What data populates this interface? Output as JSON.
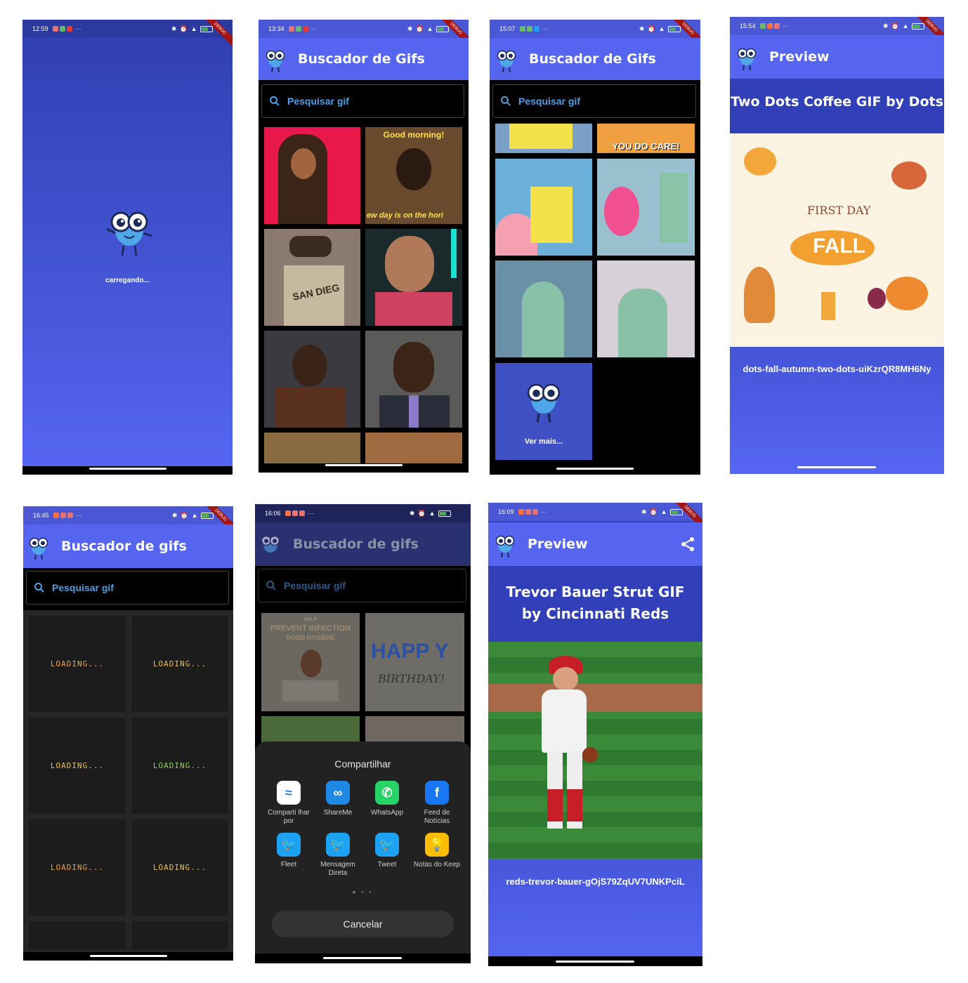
{
  "status": {
    "time_1": "12:59",
    "time_2": "13:34",
    "time_3": "15:07",
    "time_4": "15:54",
    "time_5": "16:45",
    "time_6": "16:06",
    "time_7": "16:09",
    "more": "···",
    "debug": "DEBUG"
  },
  "splash": {
    "loading_text": "carregando..."
  },
  "home": {
    "title": "Buscador de Gifs",
    "title_lower": "Buscador de gifs",
    "search_placeholder": "Pesquisar gif"
  },
  "gifs": {
    "good_morning": "Good morning!",
    "new_day": "ew day is on the hori",
    "san_diego": "SAN DIEG",
    "you_do_care": "YOU DO CARE!",
    "prevent": "PREVENT INFECTION",
    "help": "HELP",
    "good_hygiene": "GOOD HYGIENE",
    "happy": "HAPP Y",
    "birthday": "BIRTHDAY!",
    "first_day": "FIRST DAY",
    "fall": "FALL"
  },
  "more_tile": {
    "label": "Ver mais..."
  },
  "loading_tile": {
    "label": "LOADING..."
  },
  "preview": {
    "title": "Preview",
    "preview1_name": "Two Dots Coffee GIF by Dots",
    "preview1_slug": "dots-fall-autumn-two-dots-uiKzrQR8MH6Ny",
    "preview2_name": "Trevor Bauer Strut GIF by Cincinnati Reds",
    "preview2_slug": "reds-trevor-bauer-gOjS79ZqUV7UNKPciL"
  },
  "share": {
    "title": "Compartilhar",
    "cancel": "Cancelar",
    "apps": [
      {
        "label": "Comparti lhar por",
        "icon": "share-via-icon",
        "color": "#ffffff"
      },
      {
        "label": "ShareMe",
        "icon": "shareme-icon",
        "color": "#1e88e5"
      },
      {
        "label": "WhatsApp",
        "icon": "whatsapp-icon",
        "color": "#25d366"
      },
      {
        "label": "Feed de Notícias",
        "icon": "facebook-icon",
        "color": "#1877f2"
      },
      {
        "label": "Fleet",
        "icon": "twitter-icon",
        "color": "#1da1f2"
      },
      {
        "label": "Mensagem Direta",
        "icon": "twitter-icon",
        "color": "#1da1f2"
      },
      {
        "label": "Tweet",
        "icon": "twitter-icon",
        "color": "#1da1f2"
      },
      {
        "label": "Notas do Keep",
        "icon": "keep-icon",
        "color": "#fbbc04"
      }
    ]
  },
  "colors": {
    "appbar": "#5565f0",
    "title_bar_dark": "#3a4bc8",
    "gradient_top": "#2f3fb0",
    "gradient_bottom": "#5566f2",
    "search_text": "#4d9fe6"
  }
}
